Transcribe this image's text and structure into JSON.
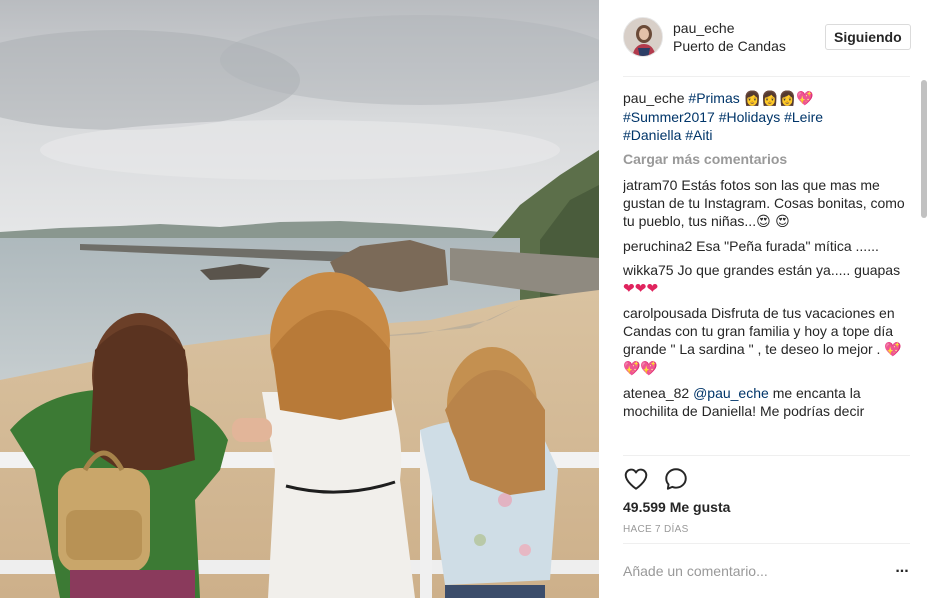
{
  "post": {
    "username": "pau_eche",
    "location": "Puerto de Candas",
    "follow_label": "Siguiendo",
    "caption": {
      "user": "pau_eche",
      "hashtag1": "#Primas",
      "emoji": "👩👩👩💖",
      "hashtag2": "#Summer2017",
      "hashtag3": "#Holidays",
      "hashtag4": "#Leire",
      "hashtag5": "#Daniella",
      "hashtag6": "#Aiti"
    },
    "load_more": "Cargar más comentarios",
    "comments": [
      {
        "user": "jatram70",
        "text": "Estás fotos son las que mas me gustan de tu Instagram. Cosas bonitas, como tu pueblo, tus niñas...",
        "emoji": "😍 😍"
      },
      {
        "user": "peruchina2",
        "text": "Esa \"Peña furada\" mítica ......",
        "emoji": ""
      },
      {
        "user": "wikka75",
        "text": "Jo que grandes están ya..... guapas",
        "emoji": "❤❤❤"
      },
      {
        "user": "carolpousada",
        "text": "Disfruta de tus vacaciones en Candas con tu gran familia y hoy a tope día grande \" La sardina \" , te deseo lo mejor .",
        "emoji": "💖💖💖"
      },
      {
        "user": "atenea_82",
        "mention": "@pau_eche",
        "text": "me encanta la mochilita de Daniella! Me podrías decir"
      }
    ],
    "likes": "49.599 Me gusta",
    "time_ago": "HACE 7 DÍAS",
    "add_comment_placeholder": "Añade un comentario...",
    "more_label": "..."
  },
  "icons": {
    "like": "heart-icon",
    "comment": "comment-bubble-icon",
    "more": "more-options-icon"
  },
  "colors": {
    "hashtag": "#003569",
    "muted": "#999999",
    "text": "#262626",
    "divider": "#efefef"
  }
}
